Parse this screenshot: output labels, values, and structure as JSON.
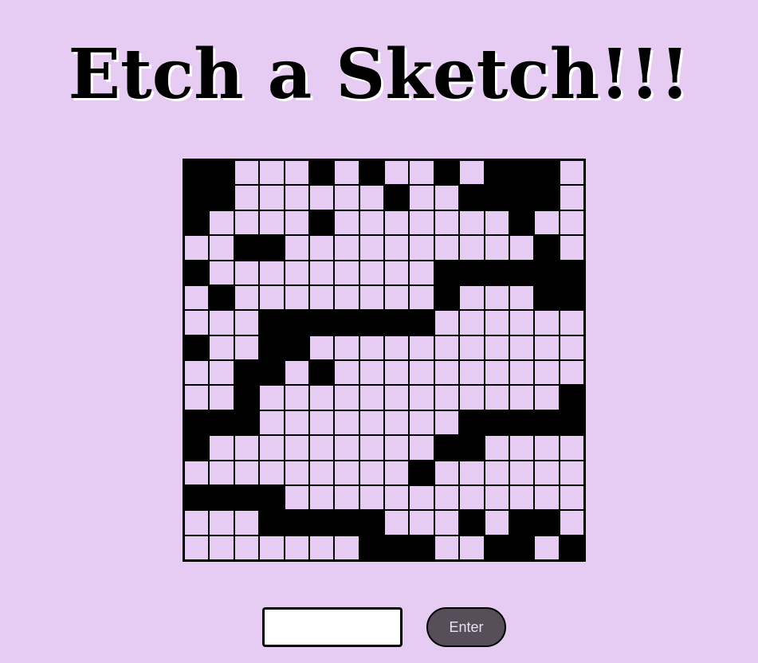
{
  "title": "Etch a Sketch!!!",
  "colors": {
    "background": "#e6cbf3",
    "filled_cell": "#000000",
    "button_bg": "#574e5a",
    "button_text": "#ebe2ef"
  },
  "grid": {
    "size": 16,
    "rows": [
      "1100010100101110",
      "1100000010011110",
      "1000010000000100",
      "0011000000000010",
      "1000000000111111",
      "0100000000100011",
      "0001111111000000",
      "1001100000000000",
      "0011010000000000",
      "0010000000000001",
      "1110000000011111",
      "1000000000110000",
      "0000000001000000",
      "1111000000000000",
      "0001111100010110",
      "0000000111001101"
    ]
  },
  "size_input": {
    "value": "",
    "placeholder": ""
  },
  "enter_button": {
    "label": "Enter"
  }
}
